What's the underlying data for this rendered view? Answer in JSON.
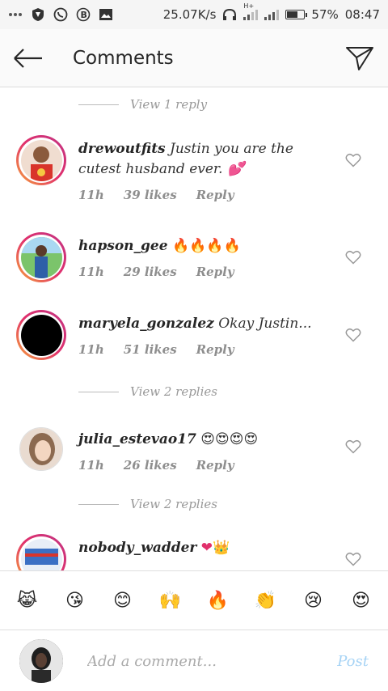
{
  "status_bar": {
    "left_icons": [
      "more-dots-icon",
      "vpn-shield-icon",
      "whatsapp-icon",
      "bitcoin-icon",
      "gallery-icon"
    ],
    "network_speed": "25.07K/s",
    "network_type": "H+",
    "battery_percent": "57%",
    "battery_level": 0.57,
    "time": "08:47"
  },
  "header": {
    "title": "Comments"
  },
  "comments": {
    "view_1": "View 1 reply",
    "items": [
      {
        "username": "drewoutfits",
        "text": "Justin you are the cutest husband ever. 💕",
        "time": "11h",
        "likes": "39 likes",
        "reply": "Reply"
      },
      {
        "username": "hapson_gee",
        "text": "🔥🔥🔥🔥",
        "time": "11h",
        "likes": "29 likes",
        "reply": "Reply"
      },
      {
        "username": "maryela_gonzalez",
        "text": "Okay Justin...",
        "time": "11h",
        "likes": "51 likes",
        "reply": "Reply"
      },
      {
        "username": "julia_estevao17",
        "text": "😍😍😍😍",
        "time": "11h",
        "likes": "26 likes",
        "reply": "Reply"
      },
      {
        "username": "nobody_wadder",
        "text": "❤👑",
        "time": "",
        "likes": "",
        "reply": ""
      }
    ],
    "view_2a": "View 2 replies",
    "view_2b": "View 2 replies"
  },
  "emoji_bar": [
    "😹",
    "😘",
    "😊",
    "🙌",
    "🔥",
    "👏",
    "😢",
    "😍"
  ],
  "composer": {
    "placeholder": "Add a comment...",
    "post_label": "Post"
  },
  "colors": {
    "story_ring_start": "#f6a53a",
    "story_ring_end": "#c13584",
    "post_button": "#a6d3f5"
  }
}
